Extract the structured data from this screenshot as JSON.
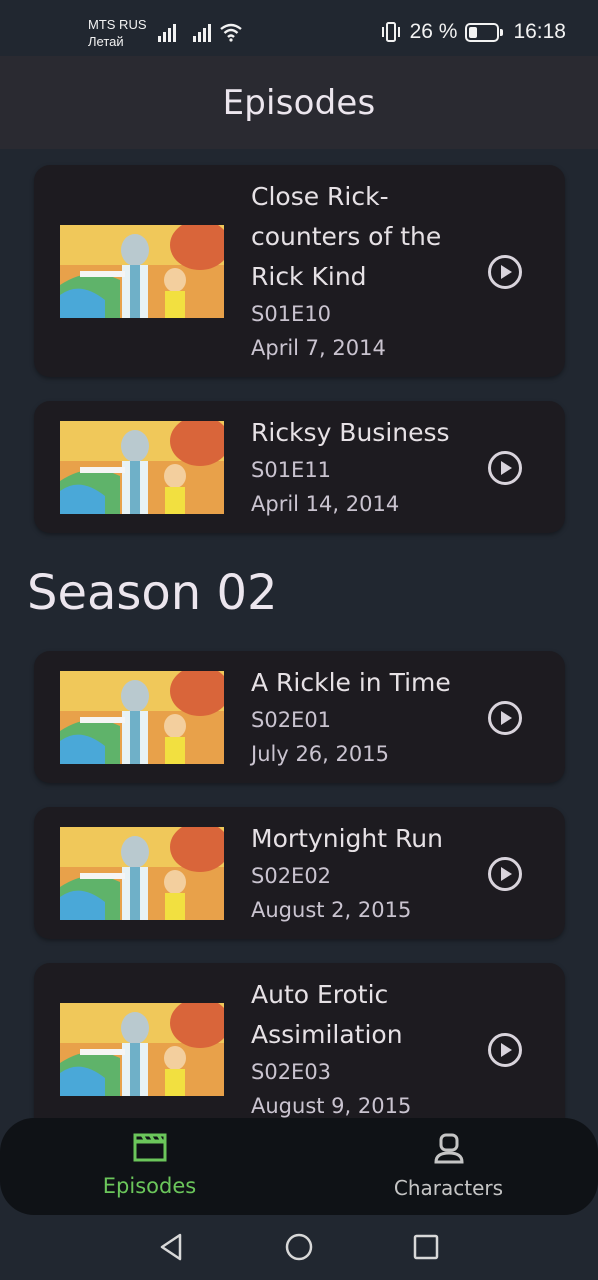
{
  "status_bar": {
    "carrier": "MTS RUS",
    "carrier2": "Летай",
    "battery": "26 %",
    "time": "16:18"
  },
  "app_bar": {
    "title": "Episodes"
  },
  "season_title": "Season 02",
  "episodes": [
    {
      "name": "Close Rick-counters of the Rick Kind",
      "code": "S01E10",
      "date": "April 7, 2014"
    },
    {
      "name": "Ricksy Business",
      "code": "S01E11",
      "date": "April 14, 2014"
    },
    {
      "name": "A Rickle in Time",
      "code": "S02E01",
      "date": "July 26, 2015"
    },
    {
      "name": "Mortynight Run",
      "code": "S02E02",
      "date": "August 2, 2015"
    },
    {
      "name": "Auto Erotic Assimilation",
      "code": "S02E03",
      "date": "August 9, 2015"
    }
  ],
  "bottom_nav": {
    "episodes_label": "Episodes",
    "characters_label": "Characters"
  },
  "colors": {
    "background": "#212730",
    "card": "#1d1b20",
    "accent": "#6bc65b",
    "app_bar": "#2a2a31"
  }
}
